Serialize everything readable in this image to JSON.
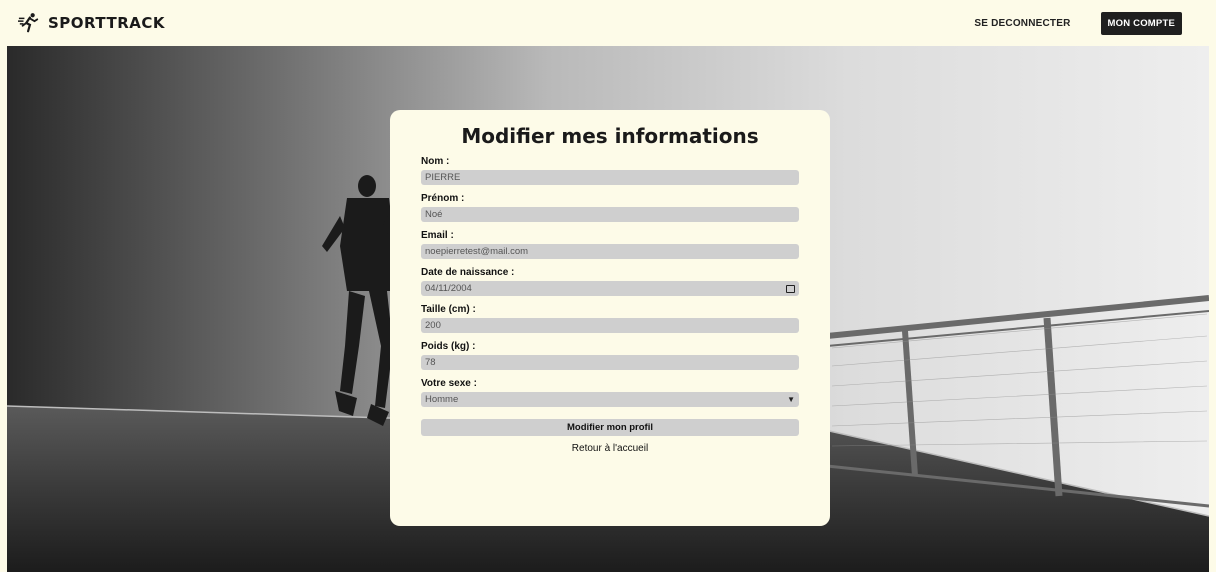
{
  "header": {
    "brand": "SPORTTRACK",
    "logout_label": "SE DECONNECTER",
    "account_label": "MON COMPTE"
  },
  "form": {
    "title": "Modifier mes informations",
    "fields": {
      "nom": {
        "label": "Nom :",
        "value": "PIERRE"
      },
      "prenom": {
        "label": "Prénom :",
        "value": "Noé"
      },
      "email": {
        "label": "Email :",
        "value": "noepierretest@mail.com"
      },
      "birthdate": {
        "label": "Date de naissance :",
        "value": "04/11/2004"
      },
      "taille": {
        "label": "Taille (cm) :",
        "value": "200"
      },
      "poids": {
        "label": "Poids (kg) :",
        "value": "78"
      },
      "sexe": {
        "label": "Votre sexe :",
        "value": "Homme"
      }
    },
    "submit_label": "Modifier mon profil",
    "back_label": "Retour à l'accueil"
  },
  "icons": {
    "brand": "runner-icon",
    "date": "calendar-icon",
    "select": "chevron-down-icon"
  },
  "colors": {
    "background": "#fdfbe8",
    "dark_button": "#1f1f1f",
    "input_bg": "#cfcfcf"
  }
}
